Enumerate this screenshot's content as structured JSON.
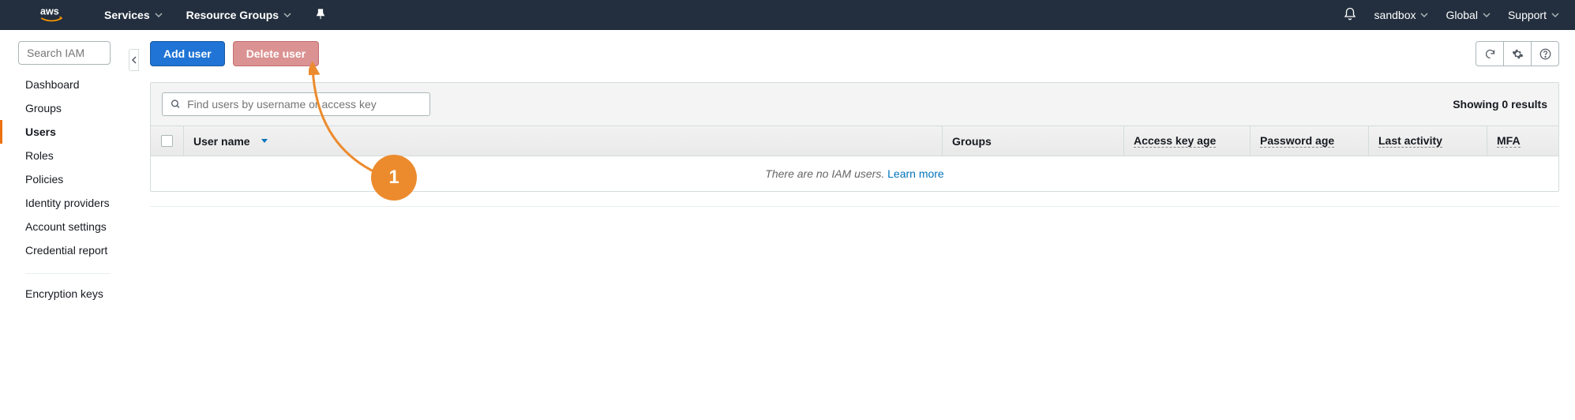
{
  "topnav": {
    "services_label": "Services",
    "resource_groups_label": "Resource Groups",
    "account_label": "sandbox",
    "region_label": "Global",
    "support_label": "Support"
  },
  "sidebar": {
    "search_placeholder": "Search IAM",
    "items": [
      {
        "label": "Dashboard"
      },
      {
        "label": "Groups"
      },
      {
        "label": "Users"
      },
      {
        "label": "Roles"
      },
      {
        "label": "Policies"
      },
      {
        "label": "Identity providers"
      },
      {
        "label": "Account settings"
      },
      {
        "label": "Credential report"
      }
    ],
    "secondary": [
      {
        "label": "Encryption keys"
      }
    ]
  },
  "actions": {
    "add_user_label": "Add user",
    "delete_user_label": "Delete user"
  },
  "panel": {
    "filter_placeholder": "Find users by username or access key",
    "results_text": "Showing 0 results"
  },
  "table": {
    "columns": {
      "username": "User name",
      "groups": "Groups",
      "access_key_age": "Access key age",
      "password_age": "Password age",
      "last_activity": "Last activity",
      "mfa": "MFA"
    },
    "empty_prefix": "There are no IAM users. ",
    "empty_link": "Learn more"
  },
  "annotation": {
    "number": "1"
  }
}
